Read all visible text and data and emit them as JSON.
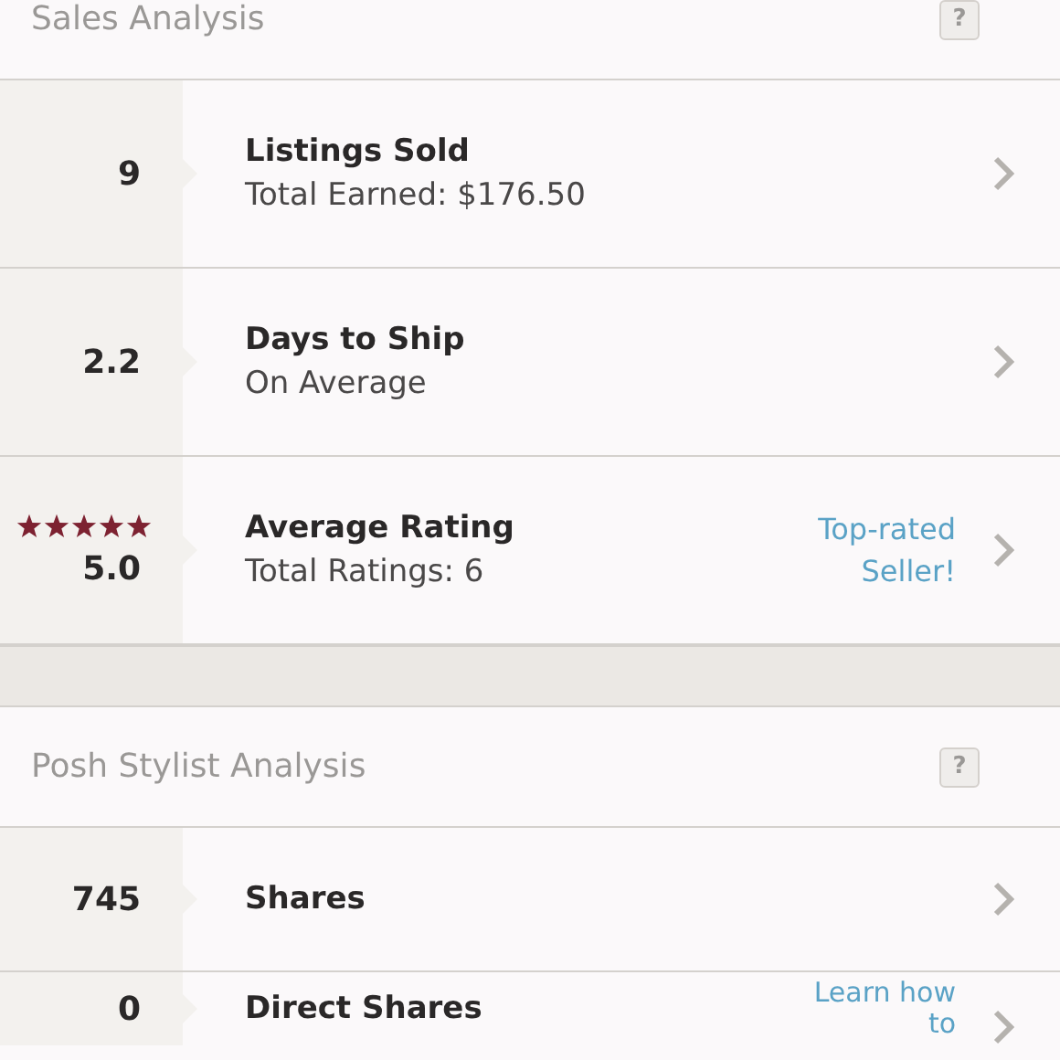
{
  "sections": [
    {
      "title": "Sales Analysis",
      "help": "?",
      "rows": [
        {
          "value": "9",
          "title": "Listings Sold",
          "subtitle": "Total Earned: $176.50"
        },
        {
          "value": "2.2",
          "title": "Days to Ship",
          "subtitle": "On Average"
        },
        {
          "value": "5.0",
          "stars": 5,
          "title": "Average Rating",
          "subtitle": "Total Ratings: 6",
          "link": "Top-rated Seller!"
        }
      ]
    },
    {
      "title": "Posh Stylist Analysis",
      "help": "?",
      "rows": [
        {
          "value": "745",
          "title": "Shares"
        },
        {
          "value": "0",
          "title": "Direct Shares",
          "link": "Learn how to"
        }
      ]
    }
  ]
}
